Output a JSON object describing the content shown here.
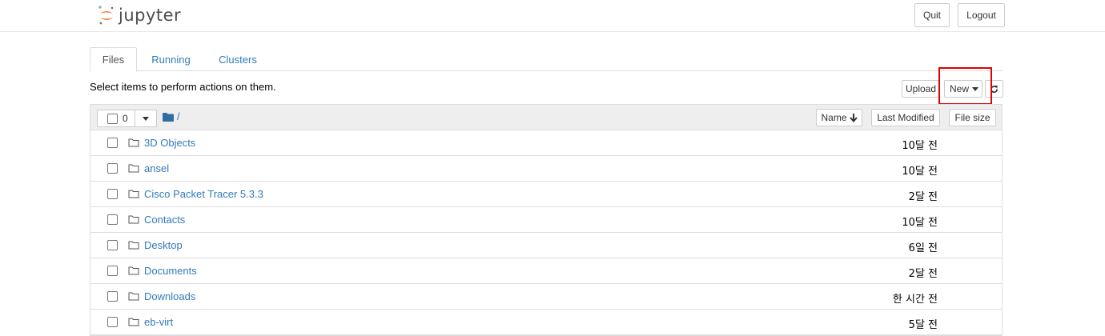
{
  "header": {
    "logo_text": "jupyter",
    "quit_label": "Quit",
    "logout_label": "Logout"
  },
  "tabs": [
    {
      "label": "Files",
      "active": true
    },
    {
      "label": "Running",
      "active": false
    },
    {
      "label": "Clusters",
      "active": false
    }
  ],
  "toolbar": {
    "instructions": "Select items to perform actions on them.",
    "upload_label": "Upload",
    "new_label": "New",
    "refresh_icon": "refresh-icon"
  },
  "list_header": {
    "selected_count": "0",
    "path": "/",
    "sort_name_label": "Name",
    "last_modified_label": "Last Modified",
    "file_size_label": "File size"
  },
  "items": [
    {
      "name": "3D Objects",
      "modified": "10달 전"
    },
    {
      "name": "ansel",
      "modified": "10달 전"
    },
    {
      "name": "Cisco Packet Tracer 5.3.3",
      "modified": "2달 전"
    },
    {
      "name": "Contacts",
      "modified": "10달 전"
    },
    {
      "name": "Desktop",
      "modified": "6일 전"
    },
    {
      "name": "Documents",
      "modified": "2달 전"
    },
    {
      "name": "Downloads",
      "modified": "한 시간 전"
    },
    {
      "name": "eb-virt",
      "modified": "5달 전"
    }
  ],
  "colors": {
    "link": "#337ab7",
    "logo_orange": "#f37726",
    "highlight": "#e00000",
    "folder_blue": "#2f6ca3"
  }
}
